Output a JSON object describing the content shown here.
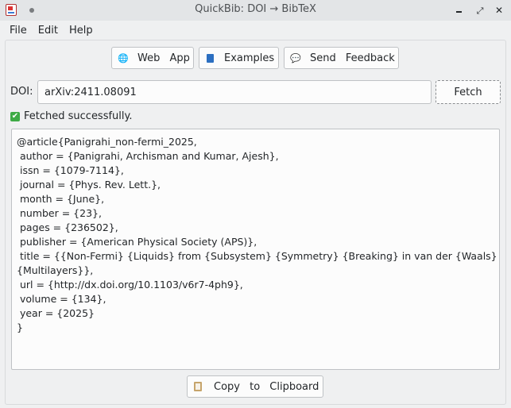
{
  "window": {
    "title": "QuickBib: DOI → BibTeX"
  },
  "menu": [
    "File",
    "Edit",
    "Help"
  ],
  "toolbar": {
    "web_app_label": "Web App",
    "examples_label": "Examples",
    "feedback_label": "Send Feedback",
    "icons": [
      "globe-icon",
      "book-icon",
      "speech-bubble-icon"
    ]
  },
  "doi": {
    "label": "DOI:",
    "value": "arXiv:2411.08091",
    "fetch_label": "Fetch"
  },
  "status": {
    "text": "Fetched successfully.",
    "icon": "check-icon",
    "color": "#3daa45"
  },
  "output": {
    "lines": [
      "@article{Panigrahi_non-fermi_2025,",
      " author = {Panigrahi, Archisman and Kumar, Ajesh},",
      " issn = {1079-7114},",
      " journal = {Phys. Rev. Lett.},",
      " month = {June},",
      " number = {23},",
      " pages = {236502},",
      " publisher = {American Physical Society (APS)},",
      " title = {{Non-Fermi} {Liquids} from {Subsystem} {Symmetry} {Breaking} in van der {Waals}",
      "{Multilayers}},",
      " url = {http://dx.doi.org/10.1103/v6r7-4ph9},",
      " volume = {134},",
      " year = {2025}",
      "}"
    ]
  },
  "copy": {
    "label": "Copy to Clipboard",
    "icon": "clipboard-icon"
  }
}
